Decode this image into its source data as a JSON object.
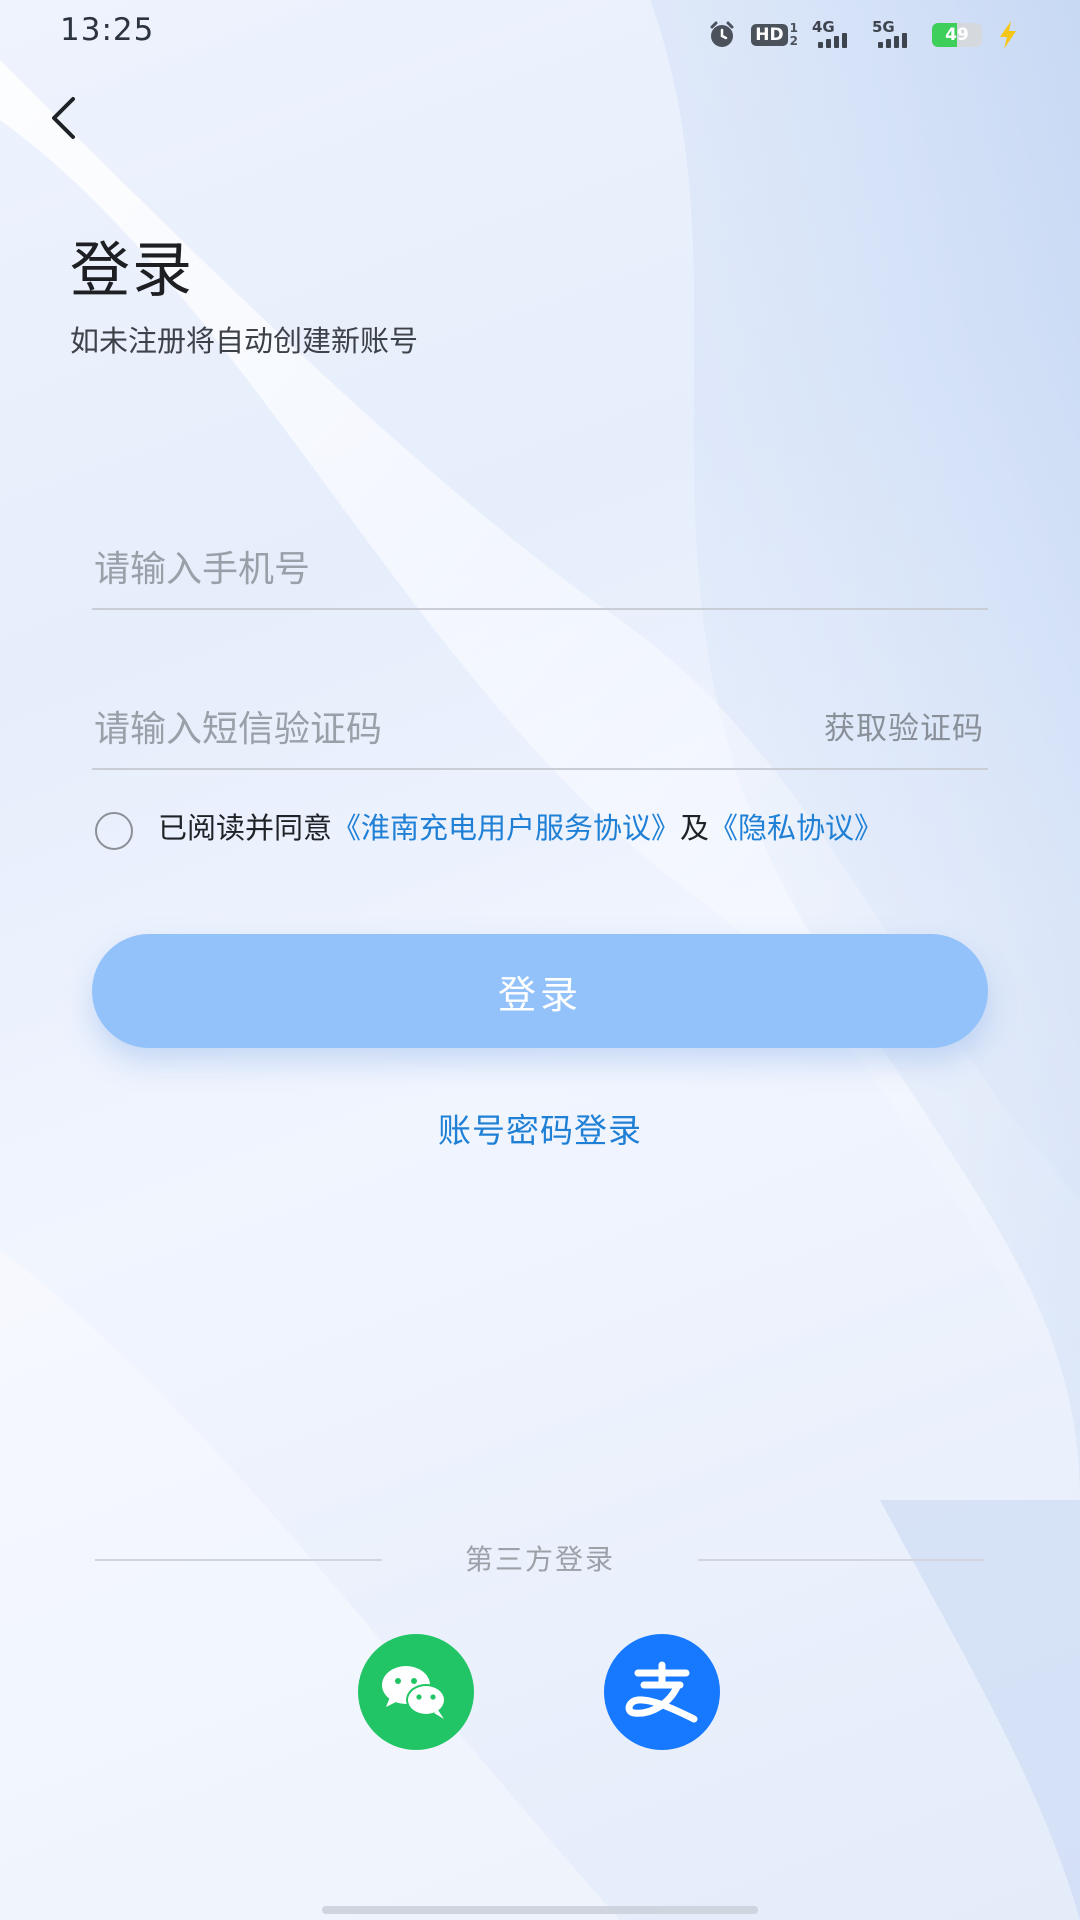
{
  "status_bar": {
    "time": "13:25",
    "hd_label": "HD",
    "hd_sim_top": "1",
    "hd_sim_bottom": "2",
    "signal_1_label": "4G",
    "signal_2_label": "5G",
    "battery_percent": "49",
    "battery_level": 0.49,
    "icons": [
      "alarm-icon",
      "hd-icon",
      "signal-4g-icon",
      "signal-5g-icon",
      "battery-icon",
      "charging-bolt-icon"
    ]
  },
  "header": {
    "back_icon": "chevron-left-icon",
    "title": "登录",
    "subtitle": "如未注册将自动创建新账号"
  },
  "form": {
    "phone_placeholder": "请输入手机号",
    "phone_value": "",
    "code_placeholder": "请输入短信验证码",
    "code_value": "",
    "get_code_label": "获取验证码",
    "agreement": {
      "checked": false,
      "prefix": "已阅读并同意",
      "service_link": "《淮南充电用户服务协议》",
      "conjunction": "及",
      "privacy_link": "《隐私协议》"
    },
    "login_button_label": "登录",
    "password_login_label": "账号密码登录"
  },
  "third_party": {
    "title": "第三方登录",
    "providers": [
      {
        "name": "wechat",
        "icon": "wechat-icon",
        "color": "#21c565"
      },
      {
        "name": "alipay",
        "icon": "alipay-icon",
        "color": "#1679ff"
      }
    ]
  },
  "colors": {
    "accent_link": "#1f80d6",
    "login_button": "#93c2fa",
    "battery_fill": "#3ecf5b",
    "charging_bolt": "#f5c518"
  }
}
